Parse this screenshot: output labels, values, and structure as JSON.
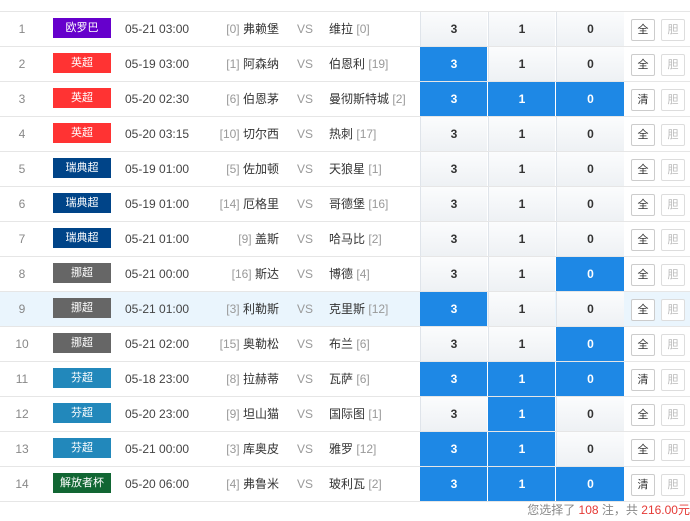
{
  "rows": [
    {
      "n": "1",
      "league": "欧罗巴",
      "color": "#6600cc",
      "time": "05-21 03:00",
      "hr": "[0]",
      "home": "弗赖堡",
      "away": "维拉",
      "ar": "[0]",
      "o3": "3",
      "o1": "1",
      "o0": "0",
      "sel": [
        0,
        0,
        0
      ],
      "btn": "全",
      "btn2": "胆"
    },
    {
      "n": "2",
      "league": "英超",
      "color": "#ff3333",
      "time": "05-19 03:00",
      "hr": "[1]",
      "home": "阿森纳",
      "away": "伯恩利",
      "ar": "[19]",
      "o3": "3",
      "o1": "1",
      "o0": "0",
      "sel": [
        1,
        0,
        0
      ],
      "btn": "全",
      "btn2": "胆"
    },
    {
      "n": "3",
      "league": "英超",
      "color": "#ff3333",
      "time": "05-20 02:30",
      "hr": "[6]",
      "home": "伯恩茅",
      "away": "曼彻斯特城",
      "ar": "[2]",
      "o3": "3",
      "o1": "1",
      "o0": "0",
      "sel": [
        1,
        1,
        1
      ],
      "btn": "清",
      "btn2": "胆"
    },
    {
      "n": "4",
      "league": "英超",
      "color": "#ff3333",
      "time": "05-20 03:15",
      "hr": "[10]",
      "home": "切尔西",
      "away": "热刺",
      "ar": "[17]",
      "o3": "3",
      "o1": "1",
      "o0": "0",
      "sel": [
        0,
        0,
        0
      ],
      "btn": "全",
      "btn2": "胆"
    },
    {
      "n": "5",
      "league": "瑞典超",
      "color": "#004488",
      "time": "05-19 01:00",
      "hr": "[5]",
      "home": "佐加顿",
      "away": "天狼星",
      "ar": "[1]",
      "o3": "3",
      "o1": "1",
      "o0": "0",
      "sel": [
        0,
        0,
        0
      ],
      "btn": "全",
      "btn2": "胆"
    },
    {
      "n": "6",
      "league": "瑞典超",
      "color": "#004488",
      "time": "05-19 01:00",
      "hr": "[14]",
      "home": "厄格里",
      "away": "哥德堡",
      "ar": "[16]",
      "o3": "3",
      "o1": "1",
      "o0": "0",
      "sel": [
        0,
        0,
        0
      ],
      "btn": "全",
      "btn2": "胆"
    },
    {
      "n": "7",
      "league": "瑞典超",
      "color": "#004488",
      "time": "05-21 01:00",
      "hr": "[9]",
      "home": "盖斯",
      "away": "哈马比",
      "ar": "[2]",
      "o3": "3",
      "o1": "1",
      "o0": "0",
      "sel": [
        0,
        0,
        0
      ],
      "btn": "全",
      "btn2": "胆"
    },
    {
      "n": "8",
      "league": "挪超",
      "color": "#666666",
      "time": "05-21 00:00",
      "hr": "[16]",
      "home": "斯达",
      "away": "博德",
      "ar": "[4]",
      "o3": "3",
      "o1": "1",
      "o0": "0",
      "sel": [
        0,
        0,
        1
      ],
      "btn": "全",
      "btn2": "胆"
    },
    {
      "n": "9",
      "league": "挪超",
      "color": "#666666",
      "time": "05-21 01:00",
      "hr": "[3]",
      "home": "利勒斯",
      "away": "克里斯",
      "ar": "[12]",
      "o3": "3",
      "o1": "1",
      "o0": "0",
      "sel": [
        1,
        0,
        0
      ],
      "btn": "全",
      "btn2": "胆",
      "hl": true
    },
    {
      "n": "10",
      "league": "挪超",
      "color": "#666666",
      "time": "05-21 02:00",
      "hr": "[15]",
      "home": "奥勒松",
      "away": "布兰",
      "ar": "[6]",
      "o3": "3",
      "o1": "1",
      "o0": "0",
      "sel": [
        0,
        0,
        1
      ],
      "btn": "全",
      "btn2": "胆"
    },
    {
      "n": "11",
      "league": "芬超",
      "color": "#2288bb",
      "time": "05-18 23:00",
      "hr": "[8]",
      "home": "拉赫蒂",
      "away": "瓦萨",
      "ar": "[6]",
      "o3": "3",
      "o1": "1",
      "o0": "0",
      "sel": [
        1,
        1,
        1
      ],
      "btn": "清",
      "btn2": "胆"
    },
    {
      "n": "12",
      "league": "芬超",
      "color": "#2288bb",
      "time": "05-20 23:00",
      "hr": "[9]",
      "home": "坦山猫",
      "away": "国际图",
      "ar": "[1]",
      "o3": "3",
      "o1": "1",
      "o0": "0",
      "sel": [
        0,
        1,
        0
      ],
      "btn": "全",
      "btn2": "胆"
    },
    {
      "n": "13",
      "league": "芬超",
      "color": "#2288bb",
      "time": "05-21 00:00",
      "hr": "[3]",
      "home": "库奥皮",
      "away": "雅罗",
      "ar": "[12]",
      "o3": "3",
      "o1": "1",
      "o0": "0",
      "sel": [
        1,
        1,
        0
      ],
      "btn": "全",
      "btn2": "胆"
    },
    {
      "n": "14",
      "league": "解放者杯",
      "color": "#116633",
      "time": "05-20 06:00",
      "hr": "[4]",
      "home": "弗鲁米",
      "away": "玻利瓦",
      "ar": "[2]",
      "o3": "3",
      "o1": "1",
      "o0": "0",
      "sel": [
        1,
        1,
        1
      ],
      "btn": "清",
      "btn2": "胆"
    }
  ],
  "vs": "VS",
  "footer": {
    "prefix": "您选择了",
    "count": "108",
    "mid": "注，共",
    "amount": "216.00元"
  }
}
